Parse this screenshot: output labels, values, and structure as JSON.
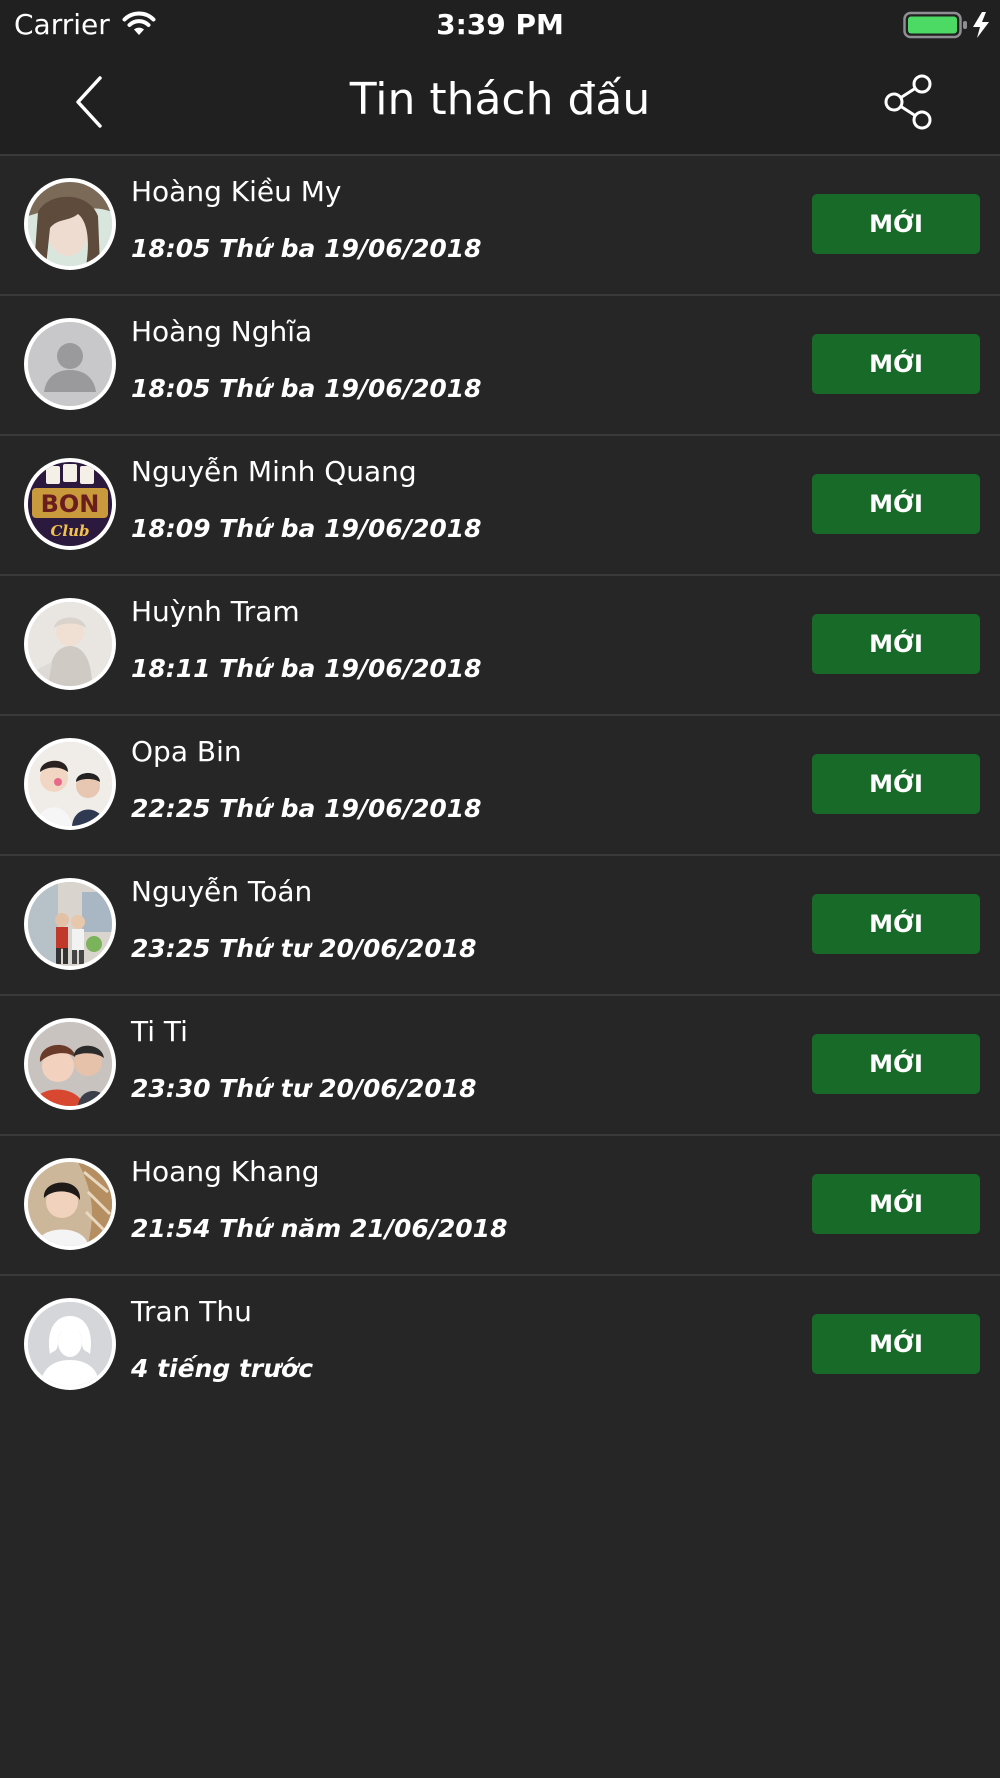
{
  "status_bar": {
    "carrier": "Carrier",
    "time": "3:39 PM",
    "icons": [
      "wifi-icon",
      "battery-charging-icon"
    ]
  },
  "nav": {
    "title": "Tin thách đấu",
    "back_icon": "chevron-left-icon",
    "share_icon": "share-icon"
  },
  "items": [
    {
      "name": "Hoàng Kiều My",
      "time": "18:05  Thứ ba 19/06/2018",
      "button": "MỚI",
      "avatar": "photo-avatar"
    },
    {
      "name": "Hoàng Nghĩa",
      "time": "18:05  Thứ ba 19/06/2018",
      "button": "MỚI",
      "avatar": "default-avatar"
    },
    {
      "name": "Nguyễn Minh Quang",
      "time": "18:09  Thứ ba 19/06/2018",
      "button": "MỚI",
      "avatar": "logo-avatar",
      "avatar_text": "BON",
      "avatar_subtext": "Club"
    },
    {
      "name": "Huỳnh Tram",
      "time": "18:11  Thứ ba 19/06/2018",
      "button": "MỚI",
      "avatar": "photo-avatar"
    },
    {
      "name": "Opa Bin",
      "time": "22:25  Thứ ba 19/06/2018",
      "button": "MỚI",
      "avatar": "photo-avatar"
    },
    {
      "name": "Nguyễn Toán",
      "time": "23:25  Thứ tư 20/06/2018",
      "button": "MỚI",
      "avatar": "photo-avatar"
    },
    {
      "name": "Ti Ti",
      "time": "23:30  Thứ tư 20/06/2018",
      "button": "MỚI",
      "avatar": "photo-avatar"
    },
    {
      "name": "Hoang Khang",
      "time": "21:54  Thứ năm 21/06/2018",
      "button": "MỚI",
      "avatar": "photo-avatar"
    },
    {
      "name": "Tran Thu",
      "time": "4 tiếng trước",
      "button": "MỚI",
      "avatar": "default-female-avatar"
    }
  ],
  "colors": {
    "background": "#262627",
    "bar_background": "#202021",
    "separator": "#3a3a3b",
    "button_green": "#176a28",
    "battery_green": "#4cd964"
  }
}
